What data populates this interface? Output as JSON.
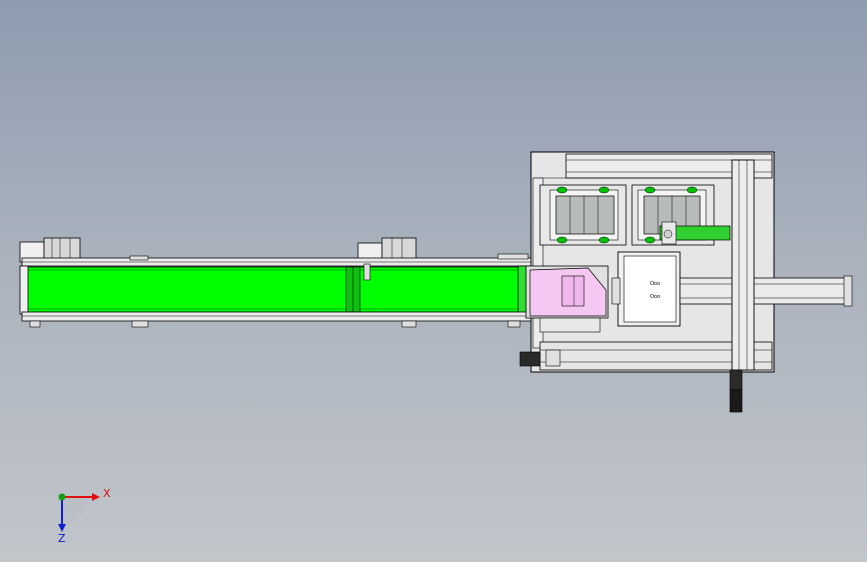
{
  "viewport": {
    "background_top": "#8e9cb0",
    "background_bottom": "#c2c6cb"
  },
  "model": {
    "conveyor_color": "#00ff00",
    "pink_block_color": "#f4c8f0",
    "frame_color": "#e4e4e4",
    "outline_color": "#000000",
    "carriage_labels": [
      "Ooo",
      "Ooo"
    ]
  },
  "triad": {
    "x_label": "X",
    "z_label": "Z",
    "x_color": "#e01010",
    "y_color": "#10a010",
    "z_color": "#1020d0"
  }
}
